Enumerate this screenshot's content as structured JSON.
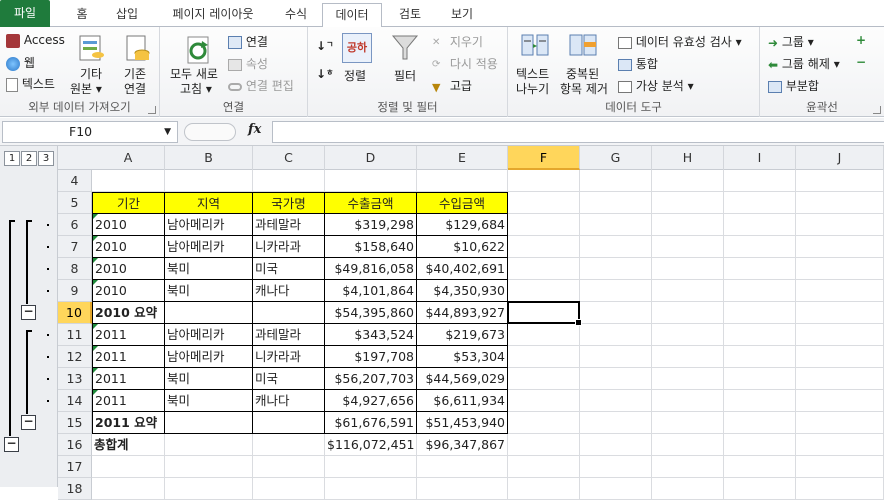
{
  "tabs": [
    "파일",
    "홈",
    "삽입",
    "페이지 레이아웃",
    "수식",
    "데이터",
    "검토",
    "보기"
  ],
  "ribbon": {
    "external": {
      "label": "외부 데이터 가져오기",
      "access": "Access",
      "web": "웹",
      "text": "텍스트",
      "other_1": "기타",
      "other_2": "원본",
      "existing_1": "기존",
      "existing_2": "연결"
    },
    "connections": {
      "label": "연결",
      "refresh_1": "모두 새로",
      "refresh_2": "고침",
      "connections": "연결",
      "properties": "속성",
      "edit_links": "연결 편집"
    },
    "sort_filter": {
      "label": "정렬 및 필터",
      "sort": "정렬",
      "sort_icon_text": "공하",
      "filter": "필터",
      "clear": "지우기",
      "reapply": "다시 적용",
      "advanced": "고급"
    },
    "data_tools": {
      "label": "데이터 도구",
      "text_to_columns_1": "텍스트",
      "text_to_columns_2": "나누기",
      "remove_dup_1": "중복된",
      "remove_dup_2": "항목 제거",
      "validation": "데이터 유효성 검사",
      "consolidate": "통합",
      "whatif": "가상 분석"
    },
    "outline": {
      "label": "윤곽선",
      "group": "그룹",
      "ungroup": "그룹 해제",
      "subtotal": "부분합"
    }
  },
  "formula_bar": {
    "name_box": "F10",
    "fx": "fx",
    "formula": ""
  },
  "outline_levels": [
    "1",
    "2",
    "3"
  ],
  "columns": [
    "A",
    "B",
    "C",
    "D",
    "E",
    "F",
    "G",
    "H",
    "I",
    "J"
  ],
  "row_numbers": [
    "4",
    "5",
    "6",
    "7",
    "8",
    "9",
    "10",
    "11",
    "12",
    "13",
    "14",
    "15",
    "16",
    "17",
    "18"
  ],
  "table": {
    "headers": [
      "기간",
      "지역",
      "국가명",
      "수출금액",
      "수입금액"
    ],
    "rows": [
      [
        "2010",
        "남아메리카",
        "과테말라",
        "$319,298",
        "$129,684"
      ],
      [
        "2010",
        "남아메리카",
        "니카라과",
        "$158,640",
        "$10,622"
      ],
      [
        "2010",
        "북미",
        "미국",
        "$49,816,058",
        "$40,402,691"
      ],
      [
        "2010",
        "북미",
        "캐나다",
        "$4,101,864",
        "$4,350,930"
      ],
      [
        "2010 요약",
        "",
        "",
        "$54,395,860",
        "$44,893,927"
      ],
      [
        "2011",
        "남아메리카",
        "과테말라",
        "$343,524",
        "$219,673"
      ],
      [
        "2011",
        "남아메리카",
        "니카라과",
        "$197,708",
        "$53,304"
      ],
      [
        "2011",
        "북미",
        "미국",
        "$56,207,703",
        "$44,569,029"
      ],
      [
        "2011",
        "북미",
        "캐나다",
        "$4,927,656",
        "$6,611,934"
      ],
      [
        "2011 요약",
        "",
        "",
        "$61,676,591",
        "$51,453,940"
      ],
      [
        "총합계",
        "",
        "",
        "$116,072,451",
        "$96,347,867"
      ]
    ]
  },
  "colors": {
    "file_tab": "#1f7b3c",
    "header_fill": "#ffff00",
    "selection_header": "#ffd65b"
  }
}
